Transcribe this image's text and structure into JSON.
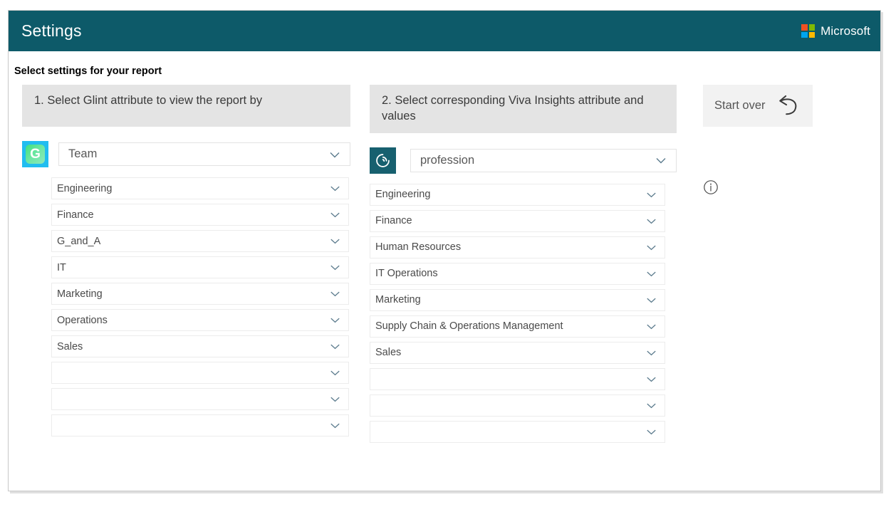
{
  "window": {
    "title": "Settings",
    "brand": {
      "name": "Microsoft",
      "logo_colors": {
        "top_left": "#f25022",
        "top_right": "#7fba00",
        "bottom_left": "#00a4ef",
        "bottom_right": "#ffb900"
      },
      "logo_icon": "microsoft-logo-icon"
    },
    "titlebar_color": "#0d5a69"
  },
  "page": {
    "section_title": "Select settings for your report"
  },
  "columns": {
    "glint": {
      "header": "1. Select Glint attribute to view the report by",
      "app_icon": "glint-logo-icon",
      "app_icon_letter": "G",
      "attribute_value": "Team",
      "attribute_chevron_icon": "chevron-down-icon",
      "values": [
        "Engineering",
        "Finance",
        "G_and_A",
        "IT",
        "Marketing",
        "Operations",
        "Sales",
        "",
        "",
        ""
      ]
    },
    "viva": {
      "header": "2. Select corresponding Viva Insights attribute and values",
      "app_icon": "viva-insights-logo-icon",
      "attribute_value": "profession",
      "attribute_chevron_icon": "chevron-down-icon",
      "values": [
        "Engineering",
        "Finance",
        "Human Resources",
        "IT Operations",
        "Marketing",
        "Supply Chain & Operations Management",
        "Sales",
        "",
        "",
        ""
      ]
    },
    "actions": {
      "start_over_label": "Start over",
      "start_over_icon": "undo-arrow-icon",
      "info_icon": "info-circle-icon"
    }
  },
  "colors": {
    "titlebar": "#0d5a69",
    "header_box": "#e4e4e4",
    "button_box": "#f2f2f2",
    "glint_outer": "#21bdf0",
    "glint_inner": "#4ee08d",
    "viva_square": "#17606f",
    "text": "#4a4a4a"
  }
}
